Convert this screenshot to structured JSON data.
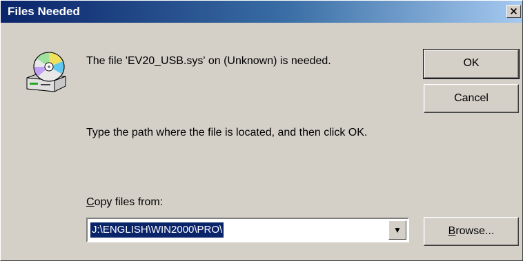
{
  "window": {
    "title": "Files Needed",
    "close_glyph": "×"
  },
  "message": {
    "line1": "The file 'EV20_USB.sys' on (Unknown) is needed.",
    "line2": "Type the path where the file is located, and then click OK."
  },
  "copy_from": {
    "label_accel": "C",
    "label_rest": "opy files from:",
    "value": "J:\\ENGLISH\\WIN2000\\PRO\\",
    "dropdown_glyph": "▼"
  },
  "buttons": {
    "ok": "OK",
    "cancel": "Cancel",
    "browse_accel": "B",
    "browse_rest": "rowse..."
  },
  "icons": {
    "disk": "cd-drive-icon"
  }
}
